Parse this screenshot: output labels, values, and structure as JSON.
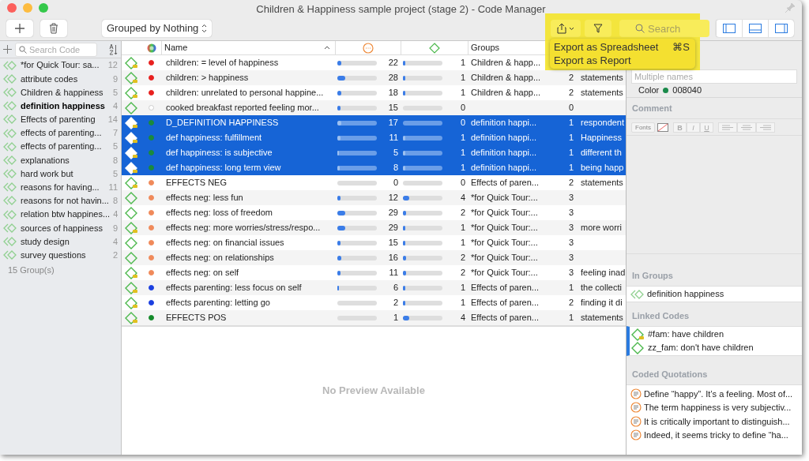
{
  "window": {
    "title": "Children & Happiness sample project (stage 2) - Code Manager"
  },
  "toolbar": {
    "group_by": "Grouped by Nothing",
    "search": {
      "placeholder": "Search"
    },
    "panel_toggles": [
      {
        "selected": true
      },
      {
        "selected": true
      },
      {
        "selected": true
      }
    ]
  },
  "export_menu": {
    "items": [
      {
        "label": "Export as Spreadsheet",
        "shortcut": "⌘S"
      },
      {
        "label": "Export as Report"
      }
    ]
  },
  "sidebar": {
    "search": {
      "placeholder": "Search Code"
    },
    "items": [
      {
        "label": "*for Quick Tour: sa...",
        "count": "12",
        "selected": false
      },
      {
        "label": "attribute codes",
        "count": "9",
        "selected": false
      },
      {
        "label": "Children & happiness",
        "count": "5",
        "selected": false
      },
      {
        "label": "definition happiness",
        "count": "4",
        "selected": true
      },
      {
        "label": "Effects of parenting",
        "count": "14",
        "selected": false
      },
      {
        "label": "effects of parenting...",
        "count": "7",
        "selected": false
      },
      {
        "label": "effects of parenting...",
        "count": "5",
        "selected": false
      },
      {
        "label": "explanations",
        "count": "8",
        "selected": false
      },
      {
        "label": "hard work but",
        "count": "5",
        "selected": false
      },
      {
        "label": "reasons for having...",
        "count": "11",
        "selected": false
      },
      {
        "label": "reasons for not havin...",
        "count": "8",
        "selected": false
      },
      {
        "label": "relation btw happines...",
        "count": "4",
        "selected": false
      },
      {
        "label": "sources of happiness",
        "count": "9",
        "selected": false
      },
      {
        "label": "study design",
        "count": "4",
        "selected": false
      },
      {
        "label": "survey questions",
        "count": "2",
        "selected": false
      }
    ],
    "footer": "15 Group(s)"
  },
  "table": {
    "columns": [
      "Name",
      "Groups"
    ],
    "rows": [
      {
        "commented": true,
        "color": "#e8201e",
        "name": "children: = level of happiness",
        "quotations": {
          "level": 0.1,
          "count": "22"
        },
        "links": {
          "level": 0.05,
          "count": "1"
        },
        "groups": "Children & happ...",
        "selected": false
      },
      {
        "commented": true,
        "color": "#e8201e",
        "name": "children: > happiness",
        "quotations": {
          "level": 0.2,
          "count": "28"
        },
        "links": {
          "level": 0.05,
          "count": "1"
        },
        "groups": "Children & happ...",
        "group_count": "2",
        "comment": "statements",
        "selected": false
      },
      {
        "commented": true,
        "color": "#e8201e",
        "name": "children: unrelated to personal happine...",
        "quotations": {
          "level": 0.1,
          "count": "18"
        },
        "links": {
          "level": 0.05,
          "count": "1"
        },
        "groups": "Children & happ...",
        "group_count": "2",
        "comment": "statements",
        "selected": false
      },
      {
        "commented": false,
        "color": "#ffffff",
        "name": "cooked breakfast reported feeling mor...",
        "quotations": {
          "level": 0.08,
          "count": "15"
        },
        "links": {
          "level": 0,
          "count": "0"
        },
        "group_count": "0",
        "selected": false
      },
      {
        "commented": true,
        "color": "#1a8a3c",
        "name": "D_DEFINITION HAPPINESS",
        "quotations": {
          "level": 0.1,
          "count": "17"
        },
        "links": {
          "level": 0,
          "count": "0"
        },
        "groups": "definition happi...",
        "group_count": "1",
        "comment": "respondent",
        "selected": true
      },
      {
        "commented": true,
        "color": "#1a8a3c",
        "name": "def happiness: fulfillment",
        "quotations": {
          "level": 0.07,
          "count": "11"
        },
        "links": {
          "level": 0.05,
          "count": "1"
        },
        "groups": "definition happi...",
        "group_count": "1",
        "comment": "Happiness",
        "selected": true
      },
      {
        "commented": true,
        "color": "#1a8a3c",
        "name": "def happiness: is subjective",
        "quotations": {
          "level": 0.03,
          "count": "5"
        },
        "links": {
          "level": 0.05,
          "count": "1"
        },
        "groups": "definition happi...",
        "group_count": "1",
        "comment": "different th",
        "selected": true
      },
      {
        "commented": true,
        "color": "#1a8a3c",
        "name": "def happiness: long term view",
        "quotations": {
          "level": 0.05,
          "count": "8"
        },
        "links": {
          "level": 0.05,
          "count": "1"
        },
        "groups": "definition happi...",
        "group_count": "1",
        "comment": "being happ",
        "selected": true
      },
      {
        "commented": true,
        "color": "#f08a5a",
        "name": "EFFECTS NEG",
        "quotations": {
          "level": 0,
          "count": "0"
        },
        "links": {
          "level": 0,
          "count": "0"
        },
        "groups": "Effects of paren...",
        "group_count": "2",
        "comment": "statements",
        "selected": false
      },
      {
        "commented": false,
        "color": "#f08a5a",
        "name": "effects neg: less fun",
        "quotations": {
          "level": 0.07,
          "count": "12"
        },
        "links": {
          "level": 0.16,
          "count": "4"
        },
        "groups": "*for Quick Tour:...",
        "group_count": "3",
        "selected": false
      },
      {
        "commented": false,
        "color": "#f08a5a",
        "name": "effects neg: loss of freedom",
        "quotations": {
          "level": 0.2,
          "count": "29"
        },
        "links": {
          "level": 0.08,
          "count": "2"
        },
        "groups": "*for Quick Tour:...",
        "group_count": "3",
        "selected": false
      },
      {
        "commented": true,
        "color": "#f08a5a",
        "name": "effects neg: more worries/stress/respo...",
        "quotations": {
          "level": 0.2,
          "count": "29"
        },
        "links": {
          "level": 0.05,
          "count": "1"
        },
        "groups": "*for Quick Tour:...",
        "group_count": "3",
        "comment": "more worri",
        "selected": false
      },
      {
        "commented": false,
        "color": "#f08a5a",
        "name": "effects neg: on financial issues",
        "quotations": {
          "level": 0.08,
          "count": "15"
        },
        "links": {
          "level": 0.05,
          "count": "1"
        },
        "groups": "*for Quick Tour:...",
        "group_count": "3",
        "selected": false
      },
      {
        "commented": false,
        "color": "#f08a5a",
        "name": "effects neg: on relationships",
        "quotations": {
          "level": 0.09,
          "count": "16"
        },
        "links": {
          "level": 0.08,
          "count": "2"
        },
        "groups": "*for Quick Tour:...",
        "group_count": "3",
        "selected": false
      },
      {
        "commented": true,
        "color": "#f08a5a",
        "name": "effects neg: on self",
        "quotations": {
          "level": 0.07,
          "count": "11"
        },
        "links": {
          "level": 0.08,
          "count": "2"
        },
        "groups": "*for Quick Tour:...",
        "group_count": "3",
        "comment": "feeling inad",
        "selected": false
      },
      {
        "commented": true,
        "color": "#1b3fe0",
        "name": "effects parenting: less focus on self",
        "quotations": {
          "level": 0.03,
          "count": "6"
        },
        "links": {
          "level": 0.05,
          "count": "1"
        },
        "groups": "Effects of paren...",
        "group_count": "1",
        "comment": "the collecti",
        "selected": false
      },
      {
        "commented": true,
        "color": "#1b3fe0",
        "name": "effects parenting: letting go",
        "quotations": {
          "level": 0,
          "count": "2"
        },
        "links": {
          "level": 0.05,
          "count": "1"
        },
        "groups": "Effects of paren...",
        "group_count": "2",
        "comment": "finding it di",
        "selected": false
      },
      {
        "commented": true,
        "color": "#148a2a",
        "name": "EFFECTS POS",
        "quotations": {
          "level": 0,
          "count": "1"
        },
        "links": {
          "level": 0.16,
          "count": "4"
        },
        "groups": "Effects of paren...",
        "group_count": "1",
        "comment": "statements",
        "selected": false
      }
    ],
    "preview": "No Preview Available"
  },
  "inspector": {
    "name_field": {
      "placeholder": "Multiple names"
    },
    "color_label": "Color",
    "color_value": "008040",
    "color": "#1a8a4a",
    "comment_title": "Comment",
    "fonts_button": "Fonts",
    "format_buttons": [
      "B",
      "I",
      "U"
    ],
    "in_groups_title": "In Groups",
    "in_groups": [
      "definition happiness"
    ],
    "linked_codes_title": "Linked Codes",
    "linked_codes": [
      {
        "label": "#fam: have children",
        "commented": true
      },
      {
        "label": "zz_fam: don't have children",
        "commented": false
      }
    ],
    "quotations_title": "Coded Quotations",
    "quotations": [
      "Define “happy”. It’s a feeling. Most of...",
      "The term happiness is very subjectiv...",
      "It is critically important to distinguish...",
      "Indeed, it seems tricky to define “ha..."
    ]
  }
}
